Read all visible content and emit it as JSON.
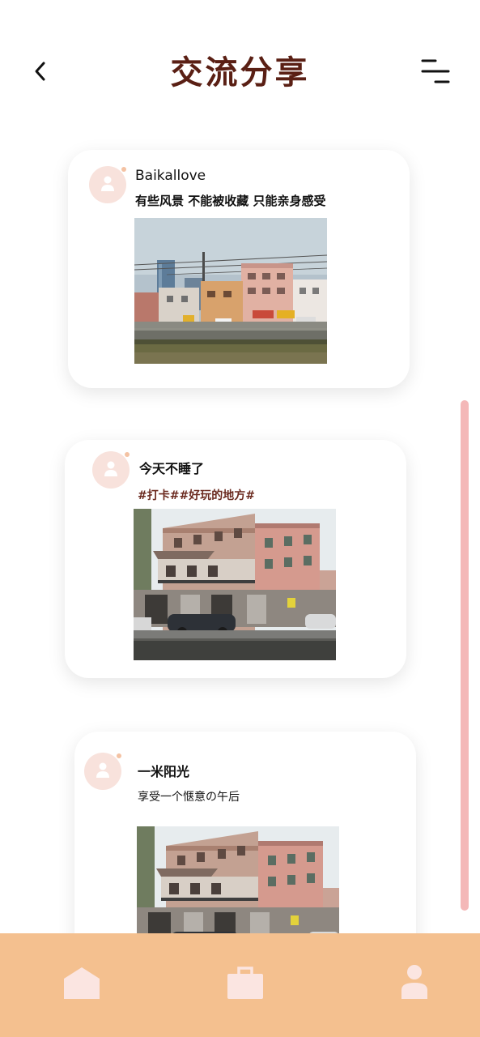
{
  "header": {
    "title": "交流分享",
    "back_icon": "chevron-left-icon",
    "menu_icon": "menu-icon"
  },
  "posts": [
    {
      "username": "Baikallove",
      "text": "有些风景 不能被收藏 只能亲身感受",
      "photo": "riverside-buildings-photo"
    },
    {
      "username": "今天不睡了",
      "tags": "#打卡##好玩的地方#",
      "photo": "old-buildings-photo"
    },
    {
      "username": "一米阳光",
      "text": "享受一个惬意の午后",
      "photo": "old-buildings-photo"
    }
  ],
  "bottom_nav": {
    "items": [
      {
        "icon": "home-icon"
      },
      {
        "icon": "briefcase-icon"
      },
      {
        "icon": "user-icon"
      }
    ]
  },
  "colors": {
    "title": "#5a1f14",
    "tag": "#6b2a1f",
    "nav_bar": "#f4c08f",
    "nav_icon": "#fbe5e1",
    "avatar": "#f8e2dc",
    "scrollbar": "#f4b8b8"
  }
}
